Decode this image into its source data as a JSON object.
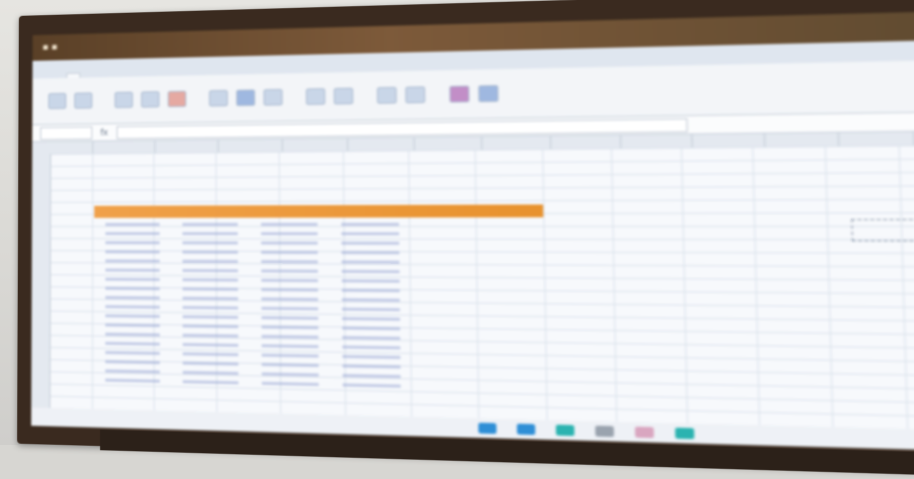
{
  "window": {
    "title_left": "",
    "app_title": ""
  },
  "ribbon": {
    "tabs": [
      "",
      "",
      "",
      "",
      "",
      "",
      "",
      ""
    ],
    "active_tab_index": 1
  },
  "formula_bar": {
    "cell_ref": "",
    "formula": ""
  },
  "sheet": {
    "title": "",
    "header_band_color": "#f0a14a",
    "columns": [
      "",
      "",
      "",
      ""
    ],
    "rows": [
      [
        "",
        "",
        "",
        ""
      ],
      [
        "",
        "",
        "",
        ""
      ],
      [
        "",
        "",
        "",
        ""
      ],
      [
        "",
        "",
        "",
        ""
      ],
      [
        "",
        "",
        "",
        ""
      ],
      [
        "",
        "",
        "",
        ""
      ],
      [
        "",
        "",
        "",
        ""
      ],
      [
        "",
        "",
        "",
        ""
      ],
      [
        "",
        "",
        "",
        ""
      ],
      [
        "",
        "",
        "",
        ""
      ],
      [
        "",
        "",
        "",
        ""
      ],
      [
        "",
        "",
        "",
        ""
      ],
      [
        "",
        "",
        "",
        ""
      ],
      [
        "",
        "",
        "",
        ""
      ],
      [
        "",
        "",
        "",
        ""
      ],
      [
        "",
        "",
        "",
        ""
      ],
      [
        "",
        "",
        "",
        ""
      ],
      [
        "",
        "",
        "",
        ""
      ]
    ],
    "total_label": "",
    "side_box_text": ""
  },
  "taskbar": {
    "icons": [
      "blue-app-icon",
      "blue-app-icon",
      "teal-app-icon",
      "gray-app-icon",
      "pink-app-icon",
      "teal-app-icon"
    ]
  },
  "colors": {
    "title_bar": "#5a4027",
    "accent": "#f0a14a",
    "cell_text": "#6b7fc0"
  }
}
